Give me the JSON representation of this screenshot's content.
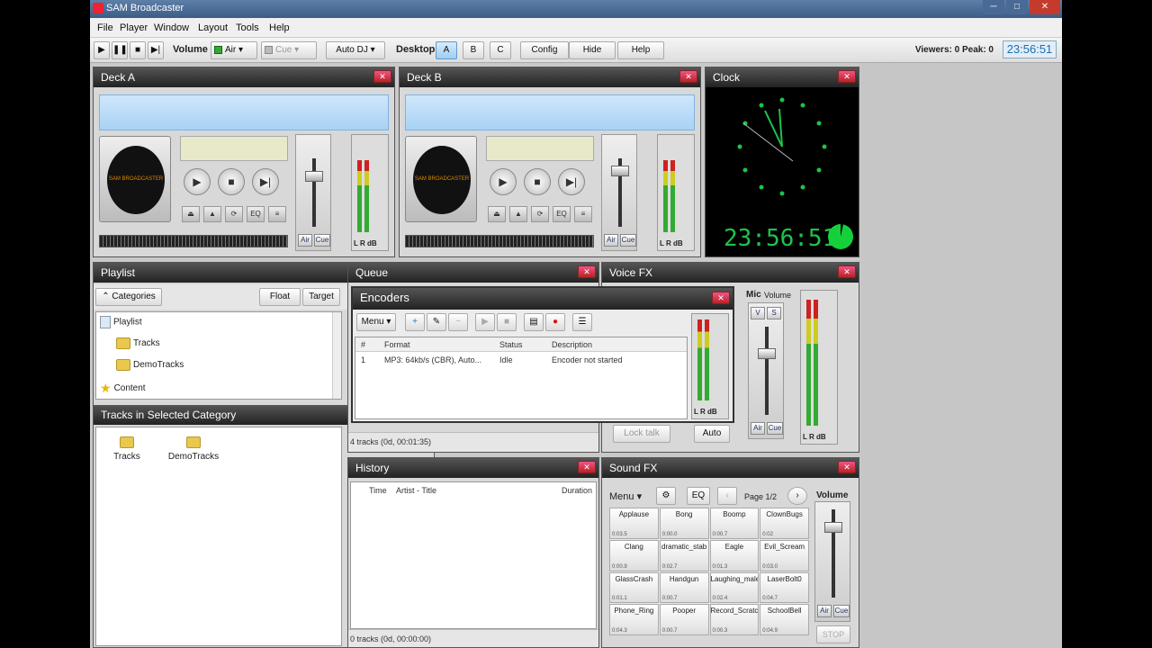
{
  "window": {
    "title": "SAM Broadcaster"
  },
  "menu": [
    "File",
    "Player",
    "Window",
    "Layout",
    "Tools",
    "Help"
  ],
  "toolbar": {
    "volume_label": "Volume",
    "air_select": "Air",
    "cue_select": "Cue",
    "autodj_select": "Auto DJ",
    "desktop_label": "Desktop",
    "desktop_a": "A",
    "desktop_b": "B",
    "desktop_c": "C",
    "config": "Config",
    "hide": "Hide",
    "help": "Help",
    "viewers": "Viewers: 0  Peak: 0",
    "time": "23:56:51"
  },
  "deck_a": {
    "title": "Deck A",
    "logo": "SAM BROADCASTER",
    "eq": "EQ",
    "vu_label": "L R dB",
    "air": "Air",
    "cue": "Cue"
  },
  "deck_b": {
    "title": "Deck B",
    "logo": "SAM BROADCASTER",
    "eq": "EQ",
    "vu_label": "L R dB",
    "air": "Air",
    "cue": "Cue"
  },
  "clock": {
    "title": "Clock",
    "digital": "23:56:51"
  },
  "playlist": {
    "title": "Playlist",
    "categories_btn": "Categories",
    "float_btn": "Float",
    "target_btn": "Target",
    "tree": [
      "Playlist",
      "Tracks",
      "DemoTracks",
      "Content"
    ],
    "tracks_title": "Tracks in Selected Category",
    "track_folders": [
      "Tracks",
      "DemoTracks"
    ]
  },
  "queue": {
    "title": "Queue",
    "status": "4 tracks (0d, 00:01:35)"
  },
  "encoders": {
    "title": "Encoders",
    "menu": "Menu",
    "columns": [
      "#",
      "Format",
      "Status",
      "Description"
    ],
    "rows": [
      {
        "num": "1",
        "format": "MP3: 64kb/s (CBR), Auto...",
        "status": "Idle",
        "description": "Encoder not started"
      }
    ],
    "vu_label": "L R dB"
  },
  "voice_fx": {
    "title": "Voice FX",
    "mic": "Mic",
    "volume": "Volume",
    "v": "V",
    "s": "S",
    "lock": "Lock talk",
    "auto": "Auto",
    "air": "Air",
    "cue": "Cue",
    "vu_label": "L R dB"
  },
  "history": {
    "title": "History",
    "col_time": "Time",
    "col_artist": "Artist - Title",
    "col_duration": "Duration",
    "status": "0 tracks (0d, 00:00:00)"
  },
  "sound_fx": {
    "title": "Sound FX",
    "menu": "Menu",
    "eq": "EQ",
    "page": "Page 1/2",
    "volume": "Volume",
    "air": "Air",
    "cue": "Cue",
    "stop": "STOP",
    "pads": [
      {
        "name": "Applause",
        "time": "0:03.5"
      },
      {
        "name": "Bong",
        "time": "0:00.0"
      },
      {
        "name": "Boomp",
        "time": "0:00.7"
      },
      {
        "name": "ClownBugs",
        "time": "0:02"
      },
      {
        "name": "Clang",
        "time": "0:00.9"
      },
      {
        "name": "dramatic_stab",
        "time": "0:02.7"
      },
      {
        "name": "Eagle",
        "time": "0:01.3"
      },
      {
        "name": "Evil_Scream",
        "time": "0:03.0"
      },
      {
        "name": "GlassCrash",
        "time": "0:01.1"
      },
      {
        "name": "Handgun",
        "time": "0:00.7"
      },
      {
        "name": "Laughing_male",
        "time": "0:02.4"
      },
      {
        "name": "LaserBolt0",
        "time": "0:04.7"
      },
      {
        "name": "Phone_Ring",
        "time": "0:04.3"
      },
      {
        "name": "Pooper",
        "time": "0:00.7"
      },
      {
        "name": "Record_Scratch",
        "time": "0:00.3"
      },
      {
        "name": "SchoolBell",
        "time": "0:04.9"
      }
    ]
  }
}
